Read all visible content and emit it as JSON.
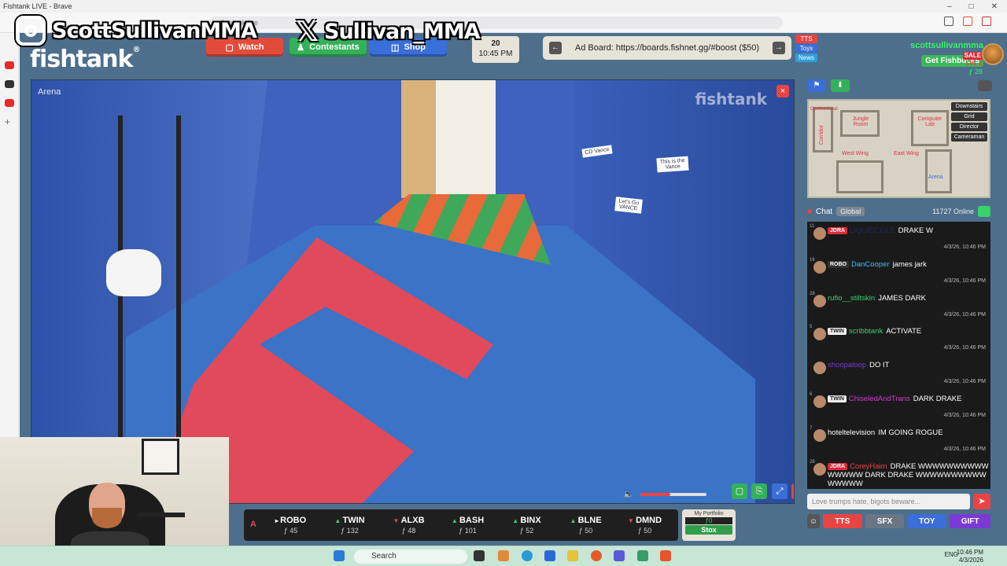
{
  "browser": {
    "title": "Fishtank LIVE - Brave",
    "url_placeholder": "fishtank.live"
  },
  "site": {
    "logo": "fishtank",
    "logo_mark": "®",
    "nav": [
      {
        "label": "Watch",
        "color": "#e24b3b"
      },
      {
        "label": "Contestants",
        "color": "#34b05a"
      },
      {
        "label": "Shop",
        "color": "#3a6ed8"
      }
    ],
    "clock": {
      "day": "20",
      "time": "10:45 PM"
    },
    "adboard": {
      "text": "Ad Board: https://boards.fishnet.gg/#boost ($50)",
      "prev": "←",
      "next": "→"
    },
    "side_buttons": [
      {
        "label": "TTS",
        "color": "#e84444"
      },
      {
        "label": "Toys",
        "color": "#3a6ed8"
      },
      {
        "label": "News",
        "color": "#2f9edb"
      }
    ],
    "user": {
      "name": "scottsullivanmma",
      "sale": "SALE",
      "level": "LVL 2",
      "fish": "ƒ 28",
      "fishbucks_label": "Get Fishbucks"
    }
  },
  "video": {
    "room_label": "Arena",
    "watermark": "fishtank",
    "close": "×",
    "signs": [
      "CD Vance",
      "Let's Go VANCE",
      "This is the Vance"
    ],
    "volume_level": 0.45,
    "colors": {
      "accent": "#e84444",
      "green": "#3ad36a",
      "blue": "#3a6ed8"
    }
  },
  "ticker": [
    {
      "name": "A",
      "dir": "dn",
      "price": ""
    },
    {
      "name": "ROBO",
      "dir": "flat",
      "price": "ƒ 45"
    },
    {
      "name": "TWIN",
      "dir": "up",
      "price": "ƒ 132"
    },
    {
      "name": "ALXB",
      "dir": "dn",
      "price": "ƒ 48"
    },
    {
      "name": "BASH",
      "dir": "up",
      "price": "ƒ 101"
    },
    {
      "name": "BINX",
      "dir": "up",
      "price": "ƒ 52"
    },
    {
      "name": "BLNE",
      "dir": "up",
      "price": "ƒ 50"
    },
    {
      "name": "DMND",
      "dir": "dn",
      "price": "ƒ 50"
    }
  ],
  "portfolio": {
    "title": "My Portfolio",
    "value": "ƒ0",
    "button": "Stox"
  },
  "map": {
    "rooms": [
      "Jungle Room",
      "Computer Lab",
      "Corridor",
      "Confessional",
      "West Wing",
      "East Wing",
      "Arena"
    ],
    "buttons": [
      "Downstairs",
      "Grid",
      "Director",
      "Cameraman"
    ]
  },
  "chat": {
    "title": "Chat",
    "tab": "Global",
    "online": "11727 Online",
    "input_placeholder": "Love trumps hate, bigots beware...",
    "messages": [
      {
        "level": "11",
        "badge": "JDRA",
        "badge_color": "#e02a3a",
        "user": "LIQUIDCOLE",
        "user_color": "#1d2a5a",
        "text": "DRAKE W",
        "time": "4/3/26, 10:46 PM"
      },
      {
        "level": "16",
        "badge": "ROBO",
        "badge_color": "#333",
        "user": "DanCooper",
        "user_color": "#3ac0ff",
        "text": "james jark",
        "time": "4/3/26, 10:46 PM"
      },
      {
        "level": "28",
        "badge": "",
        "badge_color": "",
        "user": "rufio__stiltskin",
        "user_color": "#3ad36a",
        "text": "JAMES DARK",
        "time": "4/3/26, 10:46 PM"
      },
      {
        "level": "5",
        "badge": "TWIN",
        "badge_color": "#eee",
        "user": "scribbtank",
        "user_color": "#3ad36a",
        "text": "ACTIVATE",
        "time": "4/3/26, 10:46 PM"
      },
      {
        "level": "",
        "badge": "",
        "badge_color": "",
        "user": "shoopaloop",
        "user_color": "#7a3ad3",
        "text": "DO IT",
        "time": "4/3/26, 10:46 PM"
      },
      {
        "level": "6",
        "badge": "TWIN",
        "badge_color": "#eee",
        "user": "ChiseledAndTrans",
        "user_color": "#d33ad3",
        "text": "DARK DRAKE",
        "time": "4/3/26, 10:46 PM"
      },
      {
        "level": "7",
        "badge": "",
        "badge_color": "",
        "user": "hoteltelevision",
        "user_color": "#ffffff",
        "text": "IM GOING ROGUE",
        "time": "4/3/26, 10:46 PM"
      },
      {
        "level": "28",
        "badge": "JDRA",
        "badge_color": "#e02a3a",
        "user": "CoreyHaim",
        "user_color": "#e84444",
        "text": "DRAKE WWWWWWWWWWWWWWW DARK DRAKE WWWWWWWWWWWWWWW",
        "time": ""
      }
    ],
    "buttons": [
      {
        "label": "TTS",
        "color": "#e84444"
      },
      {
        "label": "SFX",
        "color": "#6b7685"
      },
      {
        "label": "TOY",
        "color": "#3a6ed8"
      },
      {
        "label": "GIFT",
        "color": "#7a3ad3"
      }
    ]
  },
  "overlay": {
    "instagram": "ScottSullivanMMA",
    "x_handle": "Sullivan_MMA"
  },
  "taskbar": {
    "search": "Search",
    "lang": "ENG",
    "time": "10:46 PM",
    "date": "4/3/2026"
  }
}
